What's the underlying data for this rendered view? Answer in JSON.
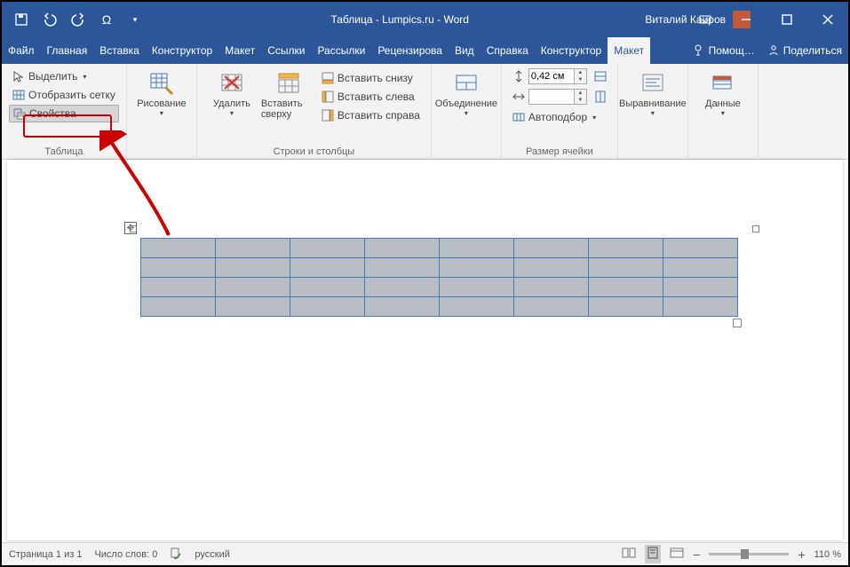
{
  "title": "Таблица - Lumpics.ru - Word",
  "user": "Виталий Каиров",
  "menu": {
    "file": "Файл",
    "home": "Главная",
    "insert": "Вставка",
    "constructor": "Конструктор",
    "layout": "Макет",
    "refs": "Ссылки",
    "mail": "Рассылки",
    "review": "Рецензирова",
    "view": "Вид",
    "help": "Справка",
    "constructor2": "Конструктор",
    "layout2": "Макет",
    "assist": "Помощ…",
    "share": "Поделиться"
  },
  "ribbon": {
    "table": {
      "label": "Таблица",
      "select": "Выделить",
      "grid": "Отобразить сетку",
      "props": "Свойства"
    },
    "draw": {
      "label": "Рисование"
    },
    "delete": {
      "label": "Удалить"
    },
    "insertTop": {
      "label": "Вставить сверху"
    },
    "insertBottom": "Вставить снизу",
    "insertLeft": "Вставить слева",
    "insertRight": "Вставить справа",
    "rowscols": "Строки и столбцы",
    "merge": {
      "label": "Объединение"
    },
    "height": "0,42 см",
    "autofit": "Автоподбор",
    "cellsize": "Размер ячейки",
    "align": {
      "label": "Выравнивание"
    },
    "data": {
      "label": "Данные"
    }
  },
  "status": {
    "page": "Страница 1 из 1",
    "words": "Число слов: 0",
    "lang": "русский",
    "zoom": "110 %"
  }
}
